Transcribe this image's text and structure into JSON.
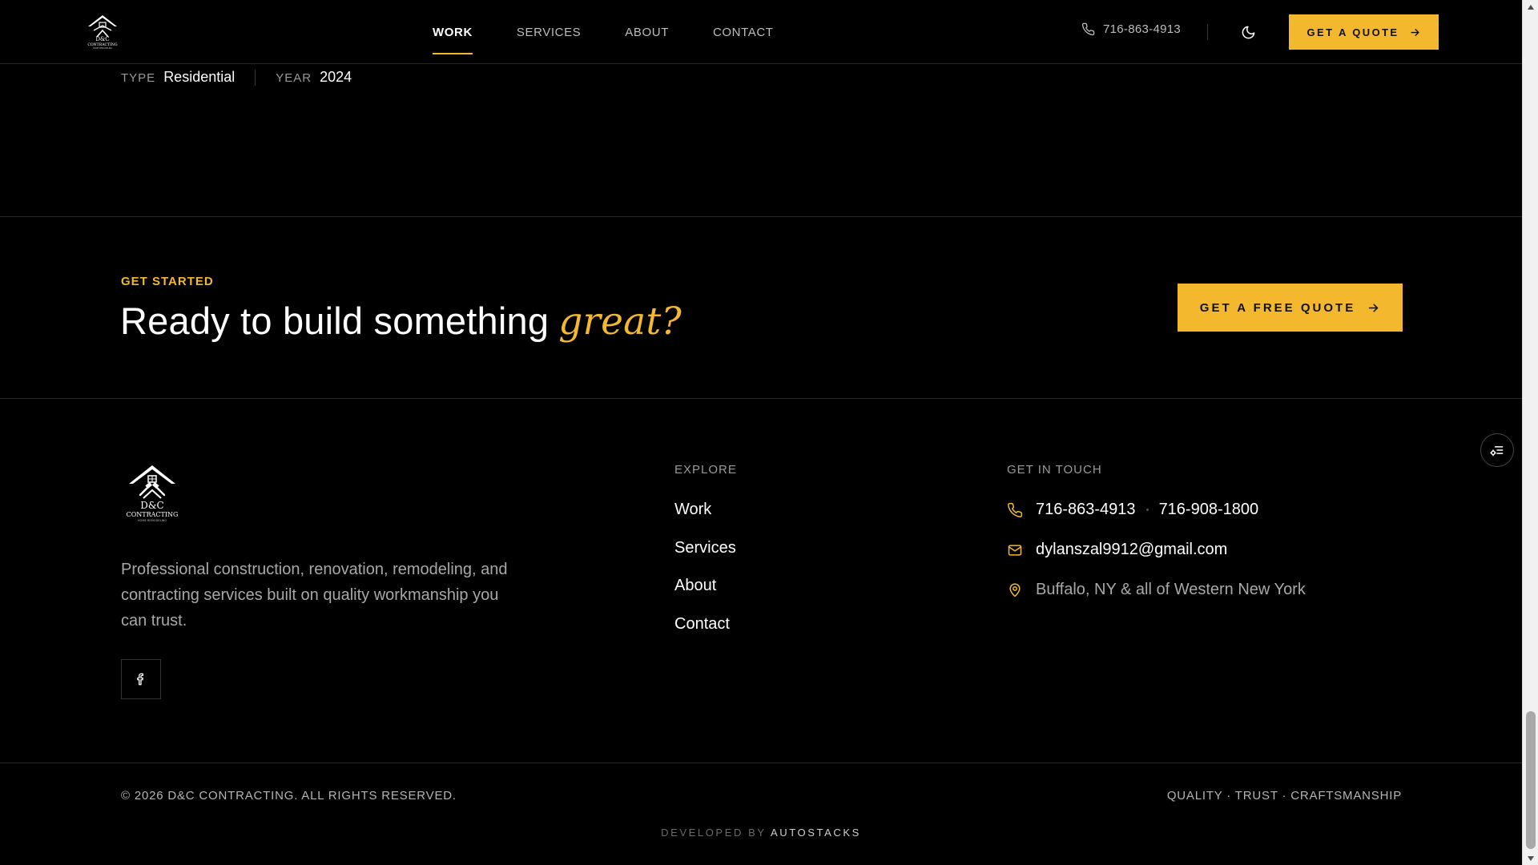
{
  "brand": {
    "logo_text": "D&C",
    "logo_sub": "CONTRACTING",
    "logo_tag": "HOME REMODELING"
  },
  "header": {
    "nav": [
      {
        "label": "WORK",
        "active": true
      },
      {
        "label": "SERVICES",
        "active": false
      },
      {
        "label": "ABOUT",
        "active": false
      },
      {
        "label": "CONTACT",
        "active": false
      }
    ],
    "phone": "716-863-4913",
    "cta_label": "GET A QUOTE"
  },
  "project_meta": {
    "type_key": "TYPE",
    "type_value": "Residential",
    "year_key": "YEAR",
    "year_value": "2024"
  },
  "cta": {
    "eyebrow": "GET STARTED",
    "heading": "Ready to build something",
    "heading_accent": "great?",
    "button_label": "GET A FREE QUOTE"
  },
  "footer": {
    "description": "Professional construction, renovation, remodeling, and contracting services built on quality workmanship you can trust.",
    "explore_title": "EXPLORE",
    "explore_links": [
      "Work",
      "Services",
      "About",
      "Contact"
    ],
    "contact_title": "GET IN TOUCH",
    "phone_1": "716-863-4913",
    "phone_2": "716-908-1800",
    "email": "dylanszal9912@gmail.com",
    "location": "Buffalo, NY & all of Western New York"
  },
  "bottom": {
    "copyright": "© 2026 D&C CONTRACTING. ALL RIGHTS RESERVED.",
    "tagline": "QUALITY · TRUST · CRAFTSMANSHIP",
    "developed_prefix": "DEVELOPED BY",
    "developed_brand": "AUTOSTACKS"
  },
  "colors": {
    "accent": "#f4b82e",
    "background": "#000000",
    "text": "#ffffff",
    "muted": "#a8a8a8"
  },
  "icons": {
    "phone": "phone-icon",
    "email": "mail-icon",
    "location": "map-pin-icon",
    "theme": "moon-icon",
    "arrow": "arrow-right-icon",
    "social": "facebook-icon",
    "float": "list-settings-icon"
  }
}
